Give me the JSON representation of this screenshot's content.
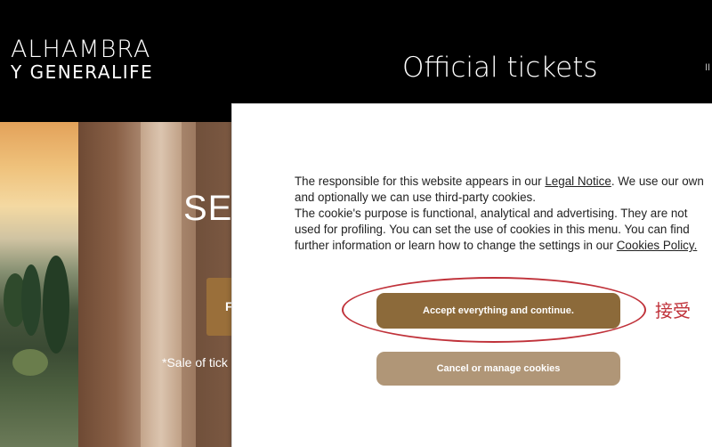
{
  "header": {
    "logo_line1": "ALHAMBRA",
    "logo_line2": "Y GENERALIFE",
    "title": "Official tickets",
    "lang_partial": "II"
  },
  "hero": {
    "heading_partial": "SE",
    "button_partial": "F",
    "note_partial": "*Sale of tick"
  },
  "cookie_banner": {
    "text_intro": "The responsible for this website appears in our ",
    "legal_notice_link": "Legal Notice",
    "text_after_legal": ". We use our own and optionally we can use third-party cookies.",
    "text_purpose": "The cookie's purpose is functional, analytical and advertising. They are not used for profiling. You can set the use of cookies in this menu. You can find further information or learn how to change the settings in our ",
    "cookies_policy_link": "Cookies Policy.",
    "accept_button": "Accept everything and continue.",
    "cancel_button": "Cancel or manage cookies"
  },
  "annotation": {
    "label": "接受",
    "color": "#c0323a"
  },
  "colors": {
    "header_bg": "#000000",
    "accept_button": "#8c6a3a",
    "cancel_button": "#b09677",
    "hero_button": "#9a6f3a"
  }
}
